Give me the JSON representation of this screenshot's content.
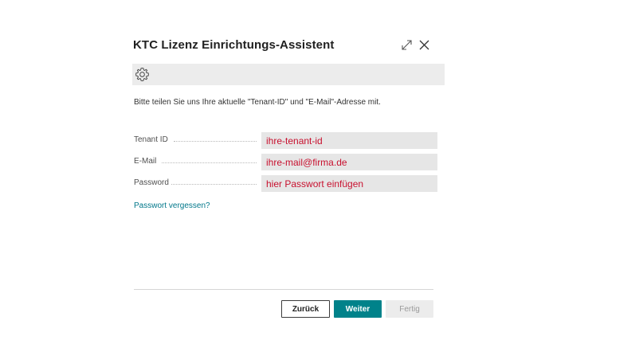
{
  "dialog": {
    "title": "KTC Lizenz Einrichtungs-Assistent",
    "expand_icon": "expand-icon",
    "close_icon": "close-icon"
  },
  "toolbar": {
    "icon": "gear-icon"
  },
  "intro_text": "Bitte teilen Sie uns Ihre aktuelle \"Tenant-ID\" und \"E-Mail\"-Adresse mit.",
  "fields": [
    {
      "label": "Tenant ID",
      "value": "ihre-tenant-id"
    },
    {
      "label": "E-Mail",
      "value": "ihre-mail@firma.de"
    },
    {
      "label": "Password",
      "value": "hier Passwort einfügen"
    }
  ],
  "forgot_password_link": "Passwort vergessen?",
  "buttons": {
    "back": "Zurück",
    "next": "Weiter",
    "finish": "Fertig"
  },
  "colors": {
    "primary": "#00828a",
    "link": "#00778a",
    "field_value": "#c8102e",
    "toolbar_bg": "#ececec"
  }
}
